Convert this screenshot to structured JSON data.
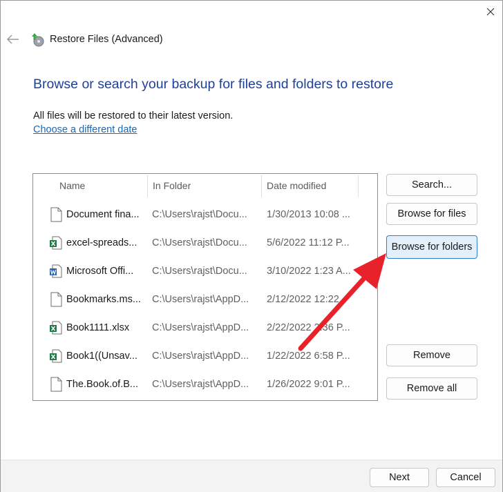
{
  "window": {
    "title": "Restore Files (Advanced)",
    "close_icon": "close-icon",
    "back_icon": "back-arrow-icon"
  },
  "heading": "Browse or search your backup for files and folders to restore",
  "info_text": "All files will be restored to their latest version.",
  "choose_date_link": "Choose a different date",
  "list": {
    "columns": [
      "Name",
      "In Folder",
      "Date modified"
    ],
    "rows": [
      {
        "icon": "document-icon",
        "name": "Document fina...",
        "folder": "C:\\Users\\rajst\\Docu...",
        "date": "1/30/2013 10:08 ..."
      },
      {
        "icon": "excel-file-icon",
        "name": "excel-spreads...",
        "folder": "C:\\Users\\rajst\\Docu...",
        "date": "5/6/2022 11:12 P..."
      },
      {
        "icon": "word-file-icon",
        "name": "Microsoft Offi...",
        "folder": "C:\\Users\\rajst\\Docu...",
        "date": "3/10/2022 1:23 A..."
      },
      {
        "icon": "document-icon",
        "name": "Bookmarks.ms...",
        "folder": "C:\\Users\\rajst\\AppD...",
        "date": "2/12/2022 12:22"
      },
      {
        "icon": "excel-file-icon",
        "name": "Book1111.xlsx",
        "folder": "C:\\Users\\rajst\\AppD...",
        "date": "2/22/2022 2:36 P..."
      },
      {
        "icon": "excel-file-icon",
        "name": "Book1((Unsav...",
        "folder": "C:\\Users\\rajst\\AppD...",
        "date": "1/22/2022 6:58 P..."
      },
      {
        "icon": "document-icon",
        "name": "The.Book.of.B...",
        "folder": "C:\\Users\\rajst\\AppD...",
        "date": "1/26/2022 9:01 P..."
      }
    ]
  },
  "buttons": {
    "search": "Search...",
    "browse_files": "Browse for files",
    "browse_folders": "Browse for folders",
    "remove": "Remove",
    "remove_all": "Remove all"
  },
  "footer": {
    "next": "Next",
    "cancel": "Cancel"
  },
  "colors": {
    "heading": "#1f3f99",
    "link": "#1a66b8",
    "focused_button_bg": "#e3f0fb",
    "focused_button_border": "#2b7fd2",
    "annotation_arrow": "#e8222b"
  }
}
